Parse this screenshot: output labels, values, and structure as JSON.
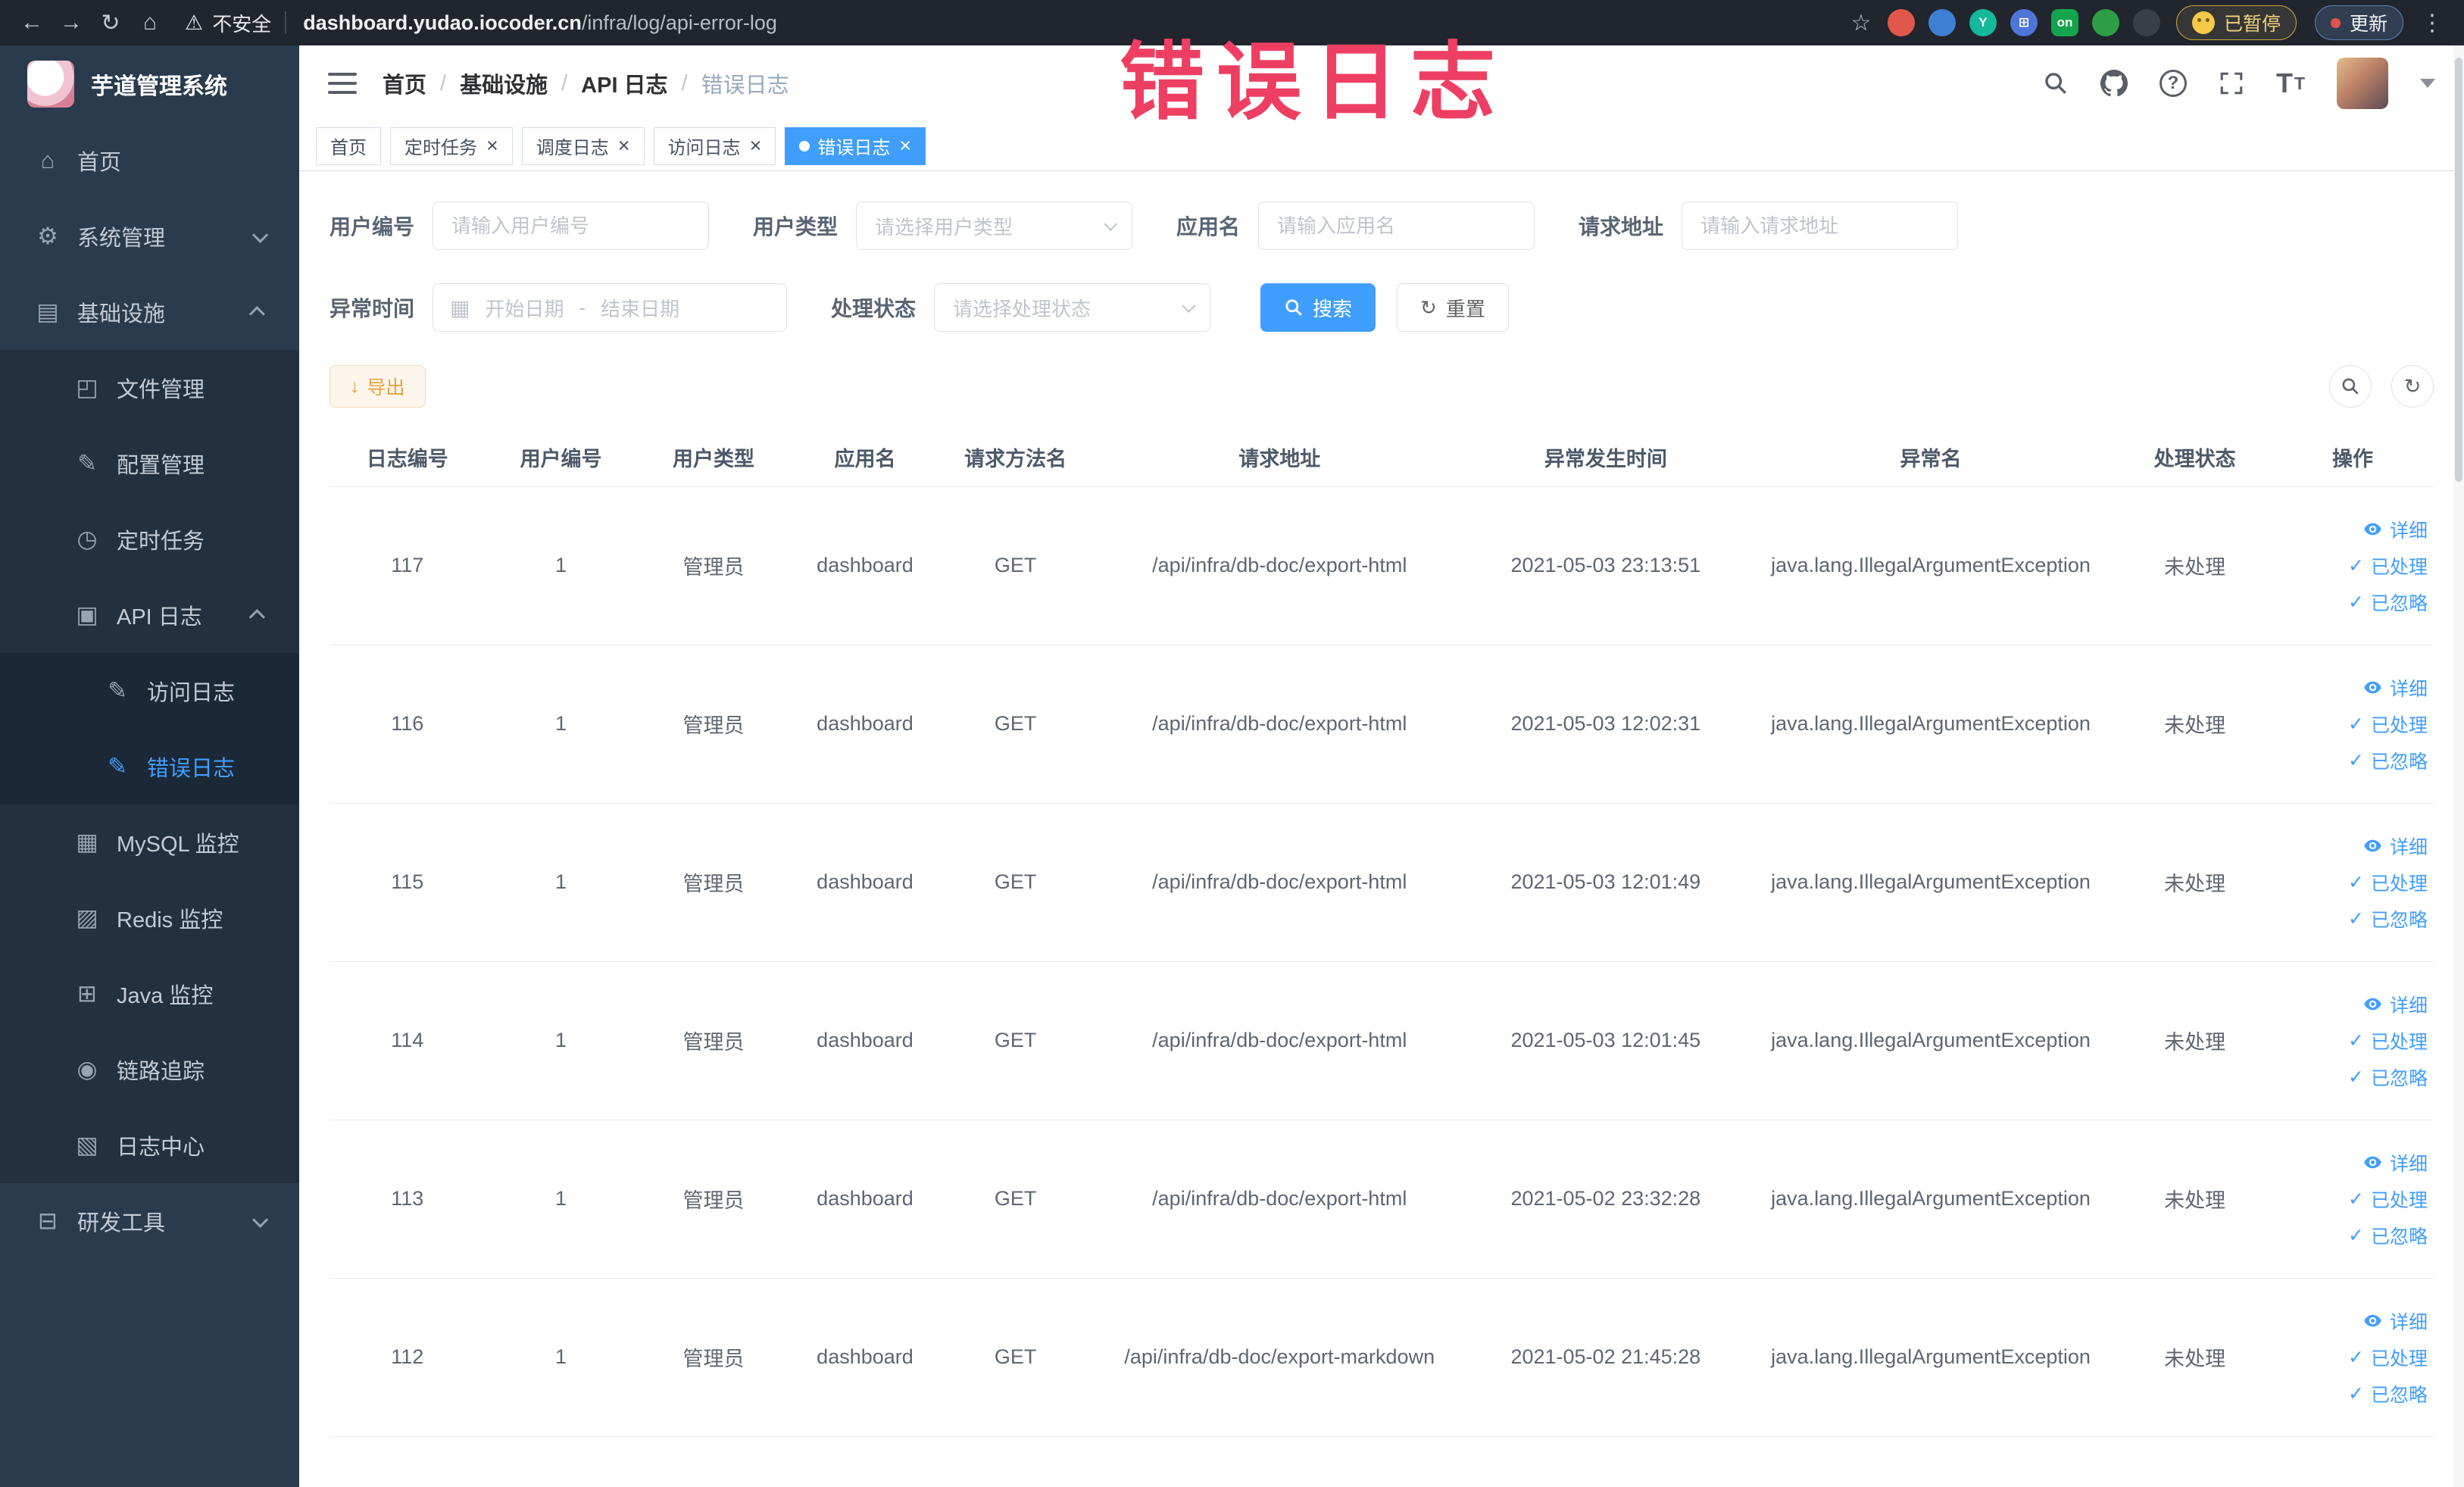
{
  "browser": {
    "security_label": "不安全",
    "url_domain": "dashboard.yudao.iocoder.cn",
    "url_path": "/infra/log/api-error-log",
    "extension_on_badge": "on",
    "paused_label": "已暂停",
    "update_label": "更新"
  },
  "annotation": {
    "text": "错误日志",
    "color": "#ee3f63"
  },
  "sidebar": {
    "logo_title": "芋道管理系统",
    "items": [
      {
        "label": "首页",
        "icon": "home-icon",
        "depth": 0
      },
      {
        "label": "系统管理",
        "icon": "gear-icon",
        "depth": 0,
        "chevron": "down"
      },
      {
        "label": "基础设施",
        "icon": "infrastructure-icon",
        "depth": 0,
        "chevron": "up"
      },
      {
        "label": "文件管理",
        "icon": "file-icon",
        "depth": 1
      },
      {
        "label": "配置管理",
        "icon": "config-icon",
        "depth": 1
      },
      {
        "label": "定时任务",
        "icon": "timer-icon",
        "depth": 1
      },
      {
        "label": "API 日志",
        "icon": "api-log-icon",
        "depth": 1,
        "chevron": "up"
      },
      {
        "label": "访问日志",
        "icon": "access-log-icon",
        "depth": 2
      },
      {
        "label": "错误日志",
        "icon": "error-log-icon",
        "depth": 2,
        "active": true
      },
      {
        "label": "MySQL 监控",
        "icon": "mysql-icon",
        "depth": 1
      },
      {
        "label": "Redis 监控",
        "icon": "redis-icon",
        "depth": 1
      },
      {
        "label": "Java 监控",
        "icon": "java-icon",
        "depth": 1
      },
      {
        "label": "链路追踪",
        "icon": "trace-icon",
        "depth": 1
      },
      {
        "label": "日志中心",
        "icon": "log-center-icon",
        "depth": 1
      },
      {
        "label": "研发工具",
        "icon": "tools-icon",
        "depth": 0,
        "chevron": "down"
      }
    ]
  },
  "header": {
    "breadcrumbs": [
      "首页",
      "基础设施",
      "API 日志",
      "错误日志"
    ]
  },
  "tabs": [
    {
      "label": "首页",
      "closable": false,
      "active": false
    },
    {
      "label": "定时任务",
      "closable": true,
      "active": false
    },
    {
      "label": "调度日志",
      "closable": true,
      "active": false
    },
    {
      "label": "访问日志",
      "closable": true,
      "active": false
    },
    {
      "label": "错误日志",
      "closable": true,
      "active": true
    }
  ],
  "filters": {
    "user_id": {
      "label": "用户编号",
      "placeholder": "请输入用户编号"
    },
    "user_type": {
      "label": "用户类型",
      "placeholder": "请选择用户类型"
    },
    "app_name": {
      "label": "应用名",
      "placeholder": "请输入应用名"
    },
    "request_url": {
      "label": "请求地址",
      "placeholder": "请输入请求地址"
    },
    "exception_time": {
      "label": "异常时间",
      "start_placeholder": "开始日期",
      "separator": "-",
      "end_placeholder": "结束日期"
    },
    "process_status": {
      "label": "处理状态",
      "placeholder": "请选择处理状态"
    },
    "search_label": "搜索",
    "reset_label": "重置"
  },
  "toolbar": {
    "export_label": "导出"
  },
  "table": {
    "headers": [
      "日志编号",
      "用户编号",
      "用户类型",
      "应用名",
      "请求方法名",
      "请求地址",
      "异常发生时间",
      "异常名",
      "处理状态",
      "操作"
    ],
    "actions": {
      "detail": "详细",
      "processed": "已处理",
      "ignored": "已忽略"
    },
    "rows": [
      {
        "id": "117",
        "user_id": "1",
        "user_type": "管理员",
        "app": "dashboard",
        "method": "GET",
        "url": "/api/infra/db-doc/export-html",
        "time": "2021-05-03 23:13:51",
        "exception": "java.lang.IllegalArgumentException",
        "status": "未处理"
      },
      {
        "id": "116",
        "user_id": "1",
        "user_type": "管理员",
        "app": "dashboard",
        "method": "GET",
        "url": "/api/infra/db-doc/export-html",
        "time": "2021-05-03 12:02:31",
        "exception": "java.lang.IllegalArgumentException",
        "status": "未处理"
      },
      {
        "id": "115",
        "user_id": "1",
        "user_type": "管理员",
        "app": "dashboard",
        "method": "GET",
        "url": "/api/infra/db-doc/export-html",
        "time": "2021-05-03 12:01:49",
        "exception": "java.lang.IllegalArgumentException",
        "status": "未处理"
      },
      {
        "id": "114",
        "user_id": "1",
        "user_type": "管理员",
        "app": "dashboard",
        "method": "GET",
        "url": "/api/infra/db-doc/export-html",
        "time": "2021-05-03 12:01:45",
        "exception": "java.lang.IllegalArgumentException",
        "status": "未处理"
      },
      {
        "id": "113",
        "user_id": "1",
        "user_type": "管理员",
        "app": "dashboard",
        "method": "GET",
        "url": "/api/infra/db-doc/export-html",
        "time": "2021-05-02 23:32:28",
        "exception": "java.lang.IllegalArgumentException",
        "status": "未处理"
      },
      {
        "id": "112",
        "user_id": "1",
        "user_type": "管理员",
        "app": "dashboard",
        "method": "GET",
        "url": "/api/infra/db-doc/export-markdown",
        "time": "2021-05-02 21:45:28",
        "exception": "java.lang.IllegalArgumentException",
        "status": "未处理"
      }
    ]
  },
  "colors": {
    "accent": "#409eff",
    "warning": "#e6a23c",
    "sidebar_bg": "#2a3b4d",
    "annotation": "#ee3f63"
  }
}
